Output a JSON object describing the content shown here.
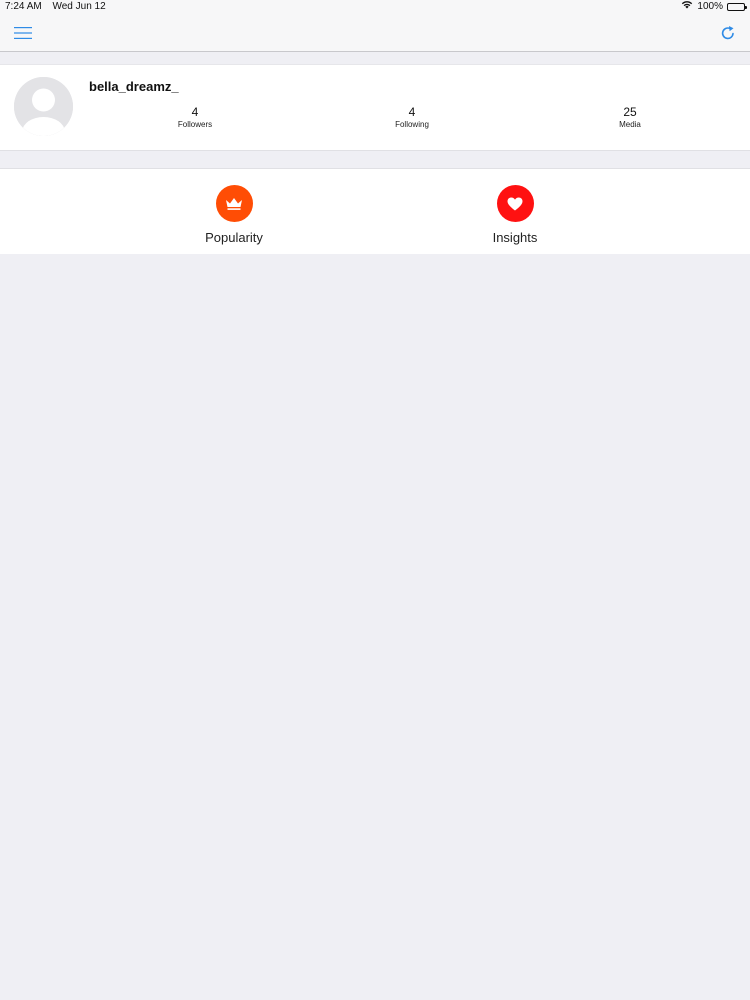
{
  "status_bar": {
    "time": "7:24 AM",
    "date": "Wed Jun 12",
    "battery": "100%",
    "icons": [
      "wifi-icon",
      "battery-icon"
    ]
  },
  "nav": {
    "left_icon": "menu-icon",
    "right_icon": "refresh-icon",
    "accent_color": "#2f8be6"
  },
  "profile": {
    "username": "bella_dreamz_",
    "avatar_icon": "user-placeholder-icon",
    "stats": [
      {
        "value": "4",
        "label": "Followers"
      },
      {
        "value": "4",
        "label": "Following"
      },
      {
        "value": "25",
        "label": "Media"
      }
    ]
  },
  "actions": [
    {
      "label": "Popularity",
      "icon": "crown-icon",
      "color": "#ff4d05"
    },
    {
      "label": "Insights",
      "icon": "heart-icon",
      "color": "#ff1111"
    }
  ]
}
